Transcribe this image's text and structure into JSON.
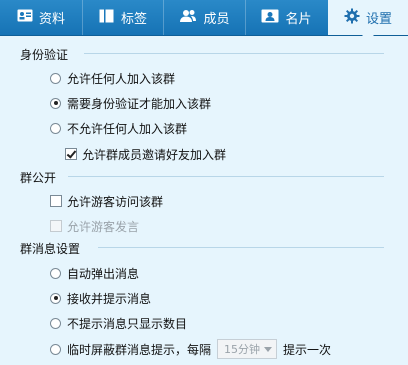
{
  "tabs": [
    {
      "label": "资料",
      "icon": "profile-card-icon"
    },
    {
      "label": "标签",
      "icon": "tag-icon"
    },
    {
      "label": "成员",
      "icon": "members-icon"
    },
    {
      "label": "名片",
      "icon": "business-card-icon"
    },
    {
      "label": "设置",
      "icon": "gear-icon",
      "active": true
    }
  ],
  "verify": {
    "title": "身份验证",
    "opt_anyone": "允许任何人加入该群",
    "opt_need_verify": "需要身份验证才能加入该群",
    "opt_nobody": "不允许任何人加入该群",
    "invite_friends": "允许群成员邀请好友加入群",
    "selected": "opt_need_verify"
  },
  "public": {
    "title": "群公开",
    "guest_visit": "允许游客访问该群",
    "guest_speak": "允许游客发言"
  },
  "msg": {
    "title": "群消息设置",
    "auto_popup": "自动弹出消息",
    "receive_notify": "接收并提示消息",
    "count_only": "不提示消息只显示数目",
    "temp_block_prefix": "临时屏蔽群消息提示，每隔",
    "interval_value": "15分钟",
    "temp_block_suffix": "提示一次",
    "selected": "receive_notify"
  },
  "colors": {
    "tabbar": "#1b78bb",
    "content_bg": "#e6f5fd",
    "active_tab_text": "#1f6fae"
  }
}
